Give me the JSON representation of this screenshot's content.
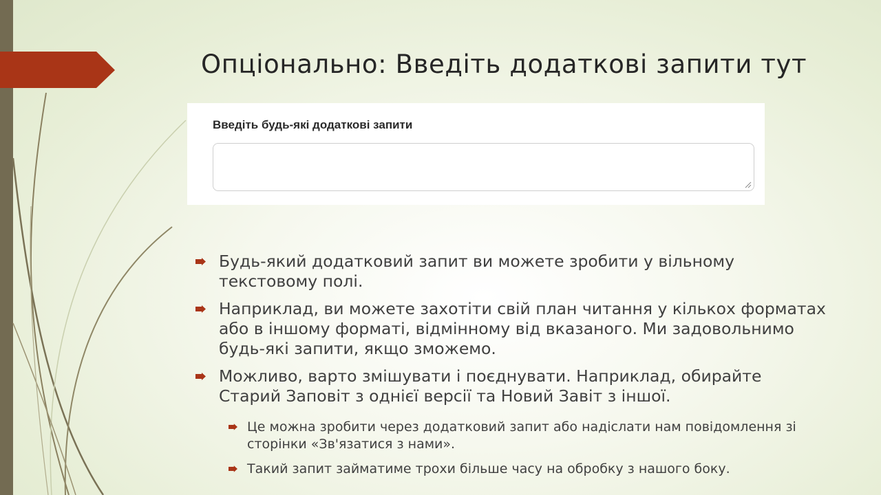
{
  "slide": {
    "title": "Опціонально: Введіть додаткові запити тут",
    "accent_color": "#a93517",
    "bar_color": "#736b52"
  },
  "form_screenshot": {
    "label": "Введіть будь-які додаткові запити",
    "textarea_value": ""
  },
  "bullets": [
    {
      "text": "Будь-який додатковий запит ви можете зробити у вільному текстовому полі."
    },
    {
      "text": "Наприклад, ви можете захотіти свій план читання у кількох форматах або в іншому форматі, відмінному від вказаного. Ми задовольнимо будь-які запити, якщо зможемо."
    },
    {
      "text": "Можливо, варто змішувати і поєднувати. Наприклад, обирайте Старий Заповіт з однієї версії та Новий Завіт з іншої.",
      "sub": [
        {
          "text": "Це можна зробити через додатковий запит або надіслати нам повідомлення зі сторінки «Зв'язатися з нами»."
        },
        {
          "text": "Такий запит займатиме трохи більше часу на обробку з нашого боку."
        }
      ]
    }
  ]
}
